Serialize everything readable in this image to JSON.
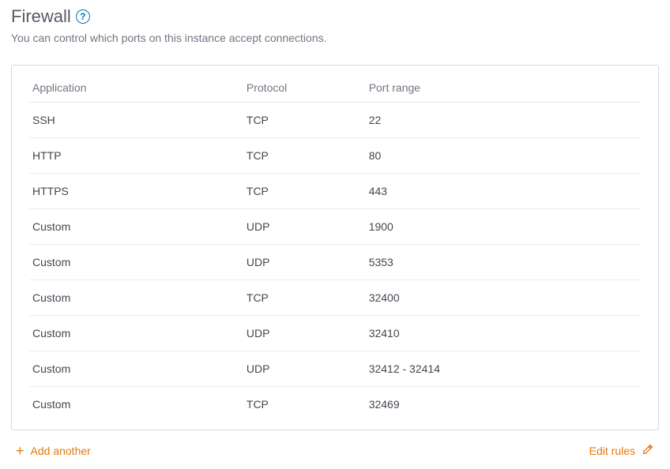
{
  "header": {
    "title": "Firewall",
    "help_glyph": "?",
    "subtitle": "You can control which ports on this instance accept connections."
  },
  "table": {
    "columns": {
      "application": "Application",
      "protocol": "Protocol",
      "port_range": "Port range"
    },
    "rows": [
      {
        "application": "SSH",
        "protocol": "TCP",
        "port_range": "22"
      },
      {
        "application": "HTTP",
        "protocol": "TCP",
        "port_range": "80"
      },
      {
        "application": "HTTPS",
        "protocol": "TCP",
        "port_range": "443"
      },
      {
        "application": "Custom",
        "protocol": "UDP",
        "port_range": "1900"
      },
      {
        "application": "Custom",
        "protocol": "UDP",
        "port_range": "5353"
      },
      {
        "application": "Custom",
        "protocol": "TCP",
        "port_range": "32400"
      },
      {
        "application": "Custom",
        "protocol": "UDP",
        "port_range": "32410"
      },
      {
        "application": "Custom",
        "protocol": "UDP",
        "port_range": "32412 - 32414"
      },
      {
        "application": "Custom",
        "protocol": "TCP",
        "port_range": "32469"
      }
    ]
  },
  "actions": {
    "add_another": "Add another",
    "edit_rules": "Edit rules"
  }
}
